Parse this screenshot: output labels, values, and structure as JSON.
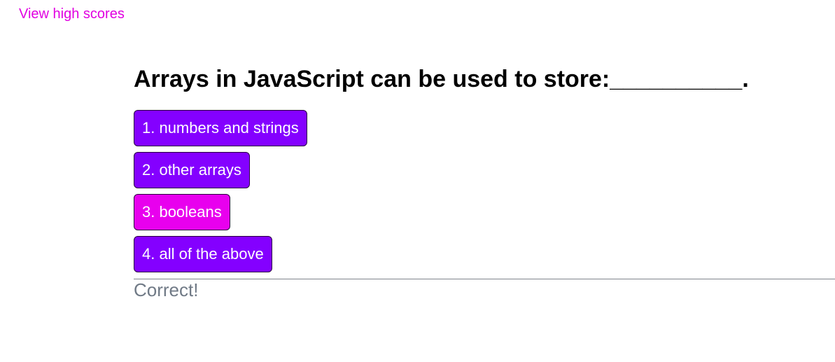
{
  "header": {
    "high_scores_link": "View high scores"
  },
  "quiz": {
    "question": "Arrays in JavaScript can be used to store:__________.",
    "answers": [
      {
        "label": "1. numbers and strings"
      },
      {
        "label": "2. other arrays"
      },
      {
        "label": "3. booleans",
        "selected": true
      },
      {
        "label": "4. all of the above"
      }
    ],
    "feedback": "Correct!"
  },
  "colors": {
    "accent": "#e100e1",
    "button": "#8400ff",
    "selected_button": "#e800ee",
    "feedback_text": "#707a86"
  }
}
